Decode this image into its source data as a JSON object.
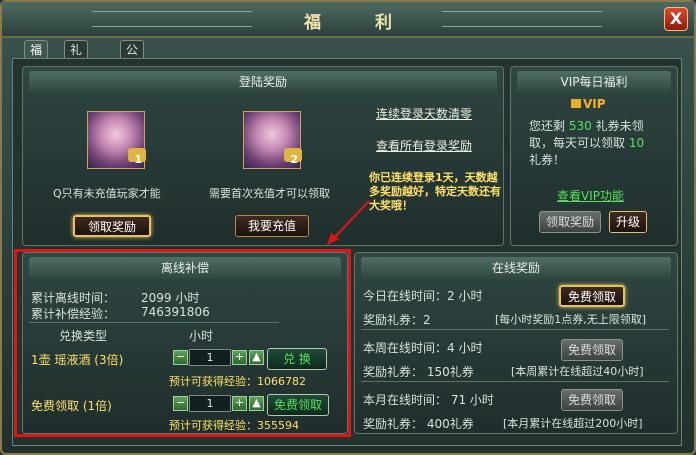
{
  "window": {
    "title": "福 利",
    "close_label": "X"
  },
  "tabs": [
    {
      "label": "福 利"
    },
    {
      "label": "礼包回馈"
    },
    {
      "label": "公 告"
    }
  ],
  "login": {
    "header": "登陆奖励",
    "card1": {
      "badge": "1",
      "desc": "Q只有未充值玩家才能",
      "button": "领取奖励"
    },
    "card2": {
      "badge": "2",
      "desc": "需要首次充值才可以领取",
      "button": "我要充值"
    },
    "link_clear": "连续登录天数清零",
    "link_all": "查看所有登录奖励",
    "streak_msg": "你已连续登录1天，天数越多奖励越好，特定天数还有大奖哦！"
  },
  "vip": {
    "header": "VIP每日福利",
    "label": "VIP",
    "line1_pre": "您还剩",
    "remaining": "530",
    "line1_post": "礼券未领",
    "line2": "取，每天可以领取",
    "daily": "10",
    "line3": "礼券！",
    "link": "查看VIP功能",
    "claim_button": "领取奖励",
    "upgrade_button": "升级"
  },
  "offline": {
    "header": "离线补偿",
    "time_label": "累计离线时间：",
    "time_value": "2099 小时",
    "exp_label": "累计补偿经验：",
    "exp_value": "746391806",
    "col_type": "兑换类型",
    "col_hours": "小时",
    "row1": {
      "label": "1壶 瑶液酒 (3倍)",
      "qty": "1",
      "button": "兑 换",
      "estimate": "预计可获得经验：1066782"
    },
    "row2": {
      "label": "免费领取 (1倍)",
      "qty": "1",
      "button": "免费领取",
      "estimate": "预计可获得经验：355594"
    }
  },
  "online": {
    "header": "在线奖励",
    "today": {
      "time": "今日在线时间：2 小时",
      "reward": "奖励礼券：2",
      "note": "[每小时奖励1点券,无上限领取]",
      "button": "免费领取"
    },
    "week": {
      "time": "本周在线时间：4 小时",
      "reward": "奖励礼券：  150礼券",
      "note": "[本周累计在线超过40小时]",
      "button": "免费领取"
    },
    "month": {
      "time": "本月在线时间：  71 小时",
      "reward": "奖励礼券：  400礼券",
      "note": "[本月累计在线超过200小时]",
      "button": "免费领取"
    }
  }
}
